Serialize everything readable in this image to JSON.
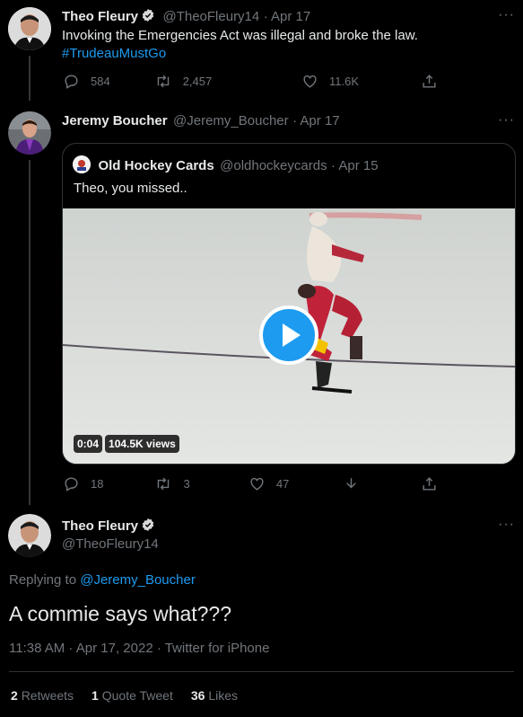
{
  "tweet1": {
    "name": "Theo Fleury",
    "handle": "@TheoFleury14",
    "date": "· Apr 17",
    "text": "Invoking the Emergencies Act was illegal and broke the law.",
    "hashtag": "#TrudeauMustGo",
    "replies": "584",
    "retweets": "2,457",
    "likes": "11.6K"
  },
  "tweet2": {
    "name": "Jeremy Boucher",
    "handle": "@Jeremy_Boucher",
    "date": "· Apr 17",
    "replies": "18",
    "retweets": "3",
    "likes": "47",
    "quote": {
      "name": "Old Hockey Cards",
      "handle": "@oldhockeycards",
      "date": "· Apr 15",
      "text": "Theo, you missed..",
      "video_time": "0:04",
      "video_views": "104.5K views"
    }
  },
  "main_tweet": {
    "name": "Theo Fleury",
    "handle": "@TheoFleury14",
    "replying_prefix": "Replying to ",
    "replying_to": "@Jeremy_Boucher",
    "text": "A commie says what???",
    "timestamp": "11:38 AM · Apr 17, 2022 · Twitter for iPhone",
    "stats": {
      "retweets_num": "2",
      "retweets_label": "Retweets",
      "quotes_num": "1",
      "quotes_label": "Quote Tweet",
      "likes_num": "36",
      "likes_label": "Likes"
    }
  },
  "more_glyph": "···",
  "colors": {
    "background": "#000000",
    "accent": "#1d9bf0",
    "secondary_text": "#71767b",
    "verified": "#d9d9d9"
  }
}
